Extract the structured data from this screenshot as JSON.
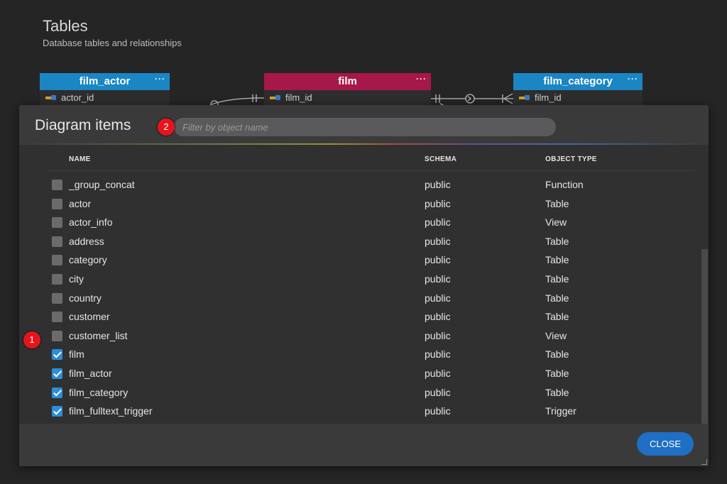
{
  "page": {
    "title": "Tables",
    "subtitle": "Database tables and relationships"
  },
  "entities": [
    {
      "name": "film_actor",
      "menu": "···",
      "fields": [
        "actor_id"
      ],
      "color": "#1a86c4"
    },
    {
      "name": "film",
      "menu": "···",
      "fields": [
        "film_id"
      ],
      "color": "#a8174a"
    },
    {
      "name": "film_category",
      "menu": "···",
      "fields": [
        "film_id"
      ],
      "color": "#1a86c4"
    }
  ],
  "dialog": {
    "title": "Diagram items",
    "filter_placeholder": "Filter by object name",
    "columns": {
      "name": "NAME",
      "schema": "SCHEMA",
      "type": "OBJECT TYPE"
    },
    "rows": [
      {
        "name": "_group_concat",
        "schema": "public",
        "type": "Function",
        "checked": false
      },
      {
        "name": "actor",
        "schema": "public",
        "type": "Table",
        "checked": false
      },
      {
        "name": "actor_info",
        "schema": "public",
        "type": "View",
        "checked": false
      },
      {
        "name": "address",
        "schema": "public",
        "type": "Table",
        "checked": false
      },
      {
        "name": "category",
        "schema": "public",
        "type": "Table",
        "checked": false
      },
      {
        "name": "city",
        "schema": "public",
        "type": "Table",
        "checked": false
      },
      {
        "name": "country",
        "schema": "public",
        "type": "Table",
        "checked": false
      },
      {
        "name": "customer",
        "schema": "public",
        "type": "Table",
        "checked": false
      },
      {
        "name": "customer_list",
        "schema": "public",
        "type": "View",
        "checked": false
      },
      {
        "name": "film",
        "schema": "public",
        "type": "Table",
        "checked": true
      },
      {
        "name": "film_actor",
        "schema": "public",
        "type": "Table",
        "checked": true
      },
      {
        "name": "film_category",
        "schema": "public",
        "type": "Table",
        "checked": true
      },
      {
        "name": "film_fulltext_trigger",
        "schema": "public",
        "type": "Trigger",
        "checked": true
      }
    ],
    "close_label": "CLOSE"
  },
  "badges": [
    "1",
    "2"
  ],
  "colors": {
    "accent": "#1f6fc5",
    "checkbox_checked": "#2b8ddc",
    "badge": "#e8141b"
  }
}
